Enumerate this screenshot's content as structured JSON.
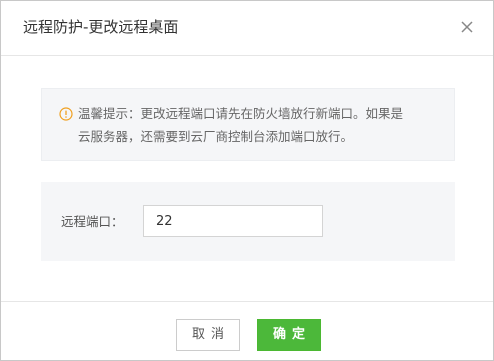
{
  "dialog": {
    "title": "远程防护-更改远程桌面",
    "close_icon": "close-icon"
  },
  "notice": {
    "icon": "warning-circle-icon",
    "line1": "温馨提示：更改远程端口请先在防火墙放行新端口。如果是",
    "line2": "云服务器，还需要到云厂商控制台添加端口放行。"
  },
  "form": {
    "port_label": "远程端口：",
    "port_value": "22"
  },
  "footer": {
    "cancel_label": "取消",
    "ok_label": "确定"
  },
  "colors": {
    "accent": "#4cb83a",
    "warning": "#f0a020"
  }
}
